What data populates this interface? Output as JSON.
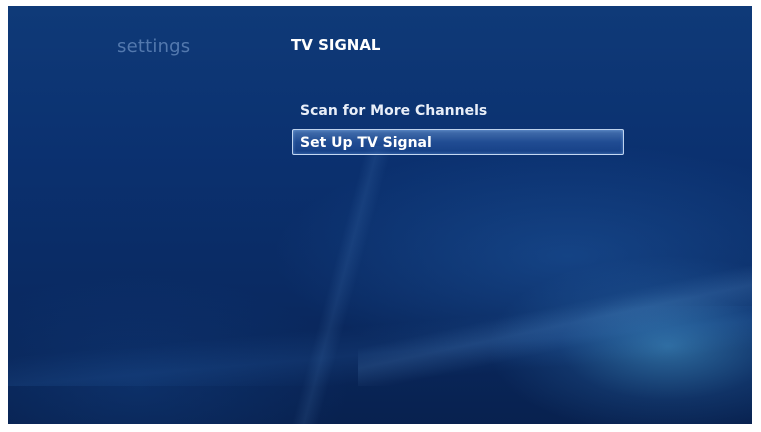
{
  "header": {
    "section_label": "settings",
    "title": "TV SIGNAL"
  },
  "menu": {
    "items": [
      {
        "label": "Scan for More Channels",
        "focused": false
      },
      {
        "label": "Set Up TV Signal",
        "focused": true
      }
    ]
  },
  "colors": {
    "background": "#0b3170",
    "focus_highlight": "#3c6ebe",
    "text": "#ffffff"
  }
}
